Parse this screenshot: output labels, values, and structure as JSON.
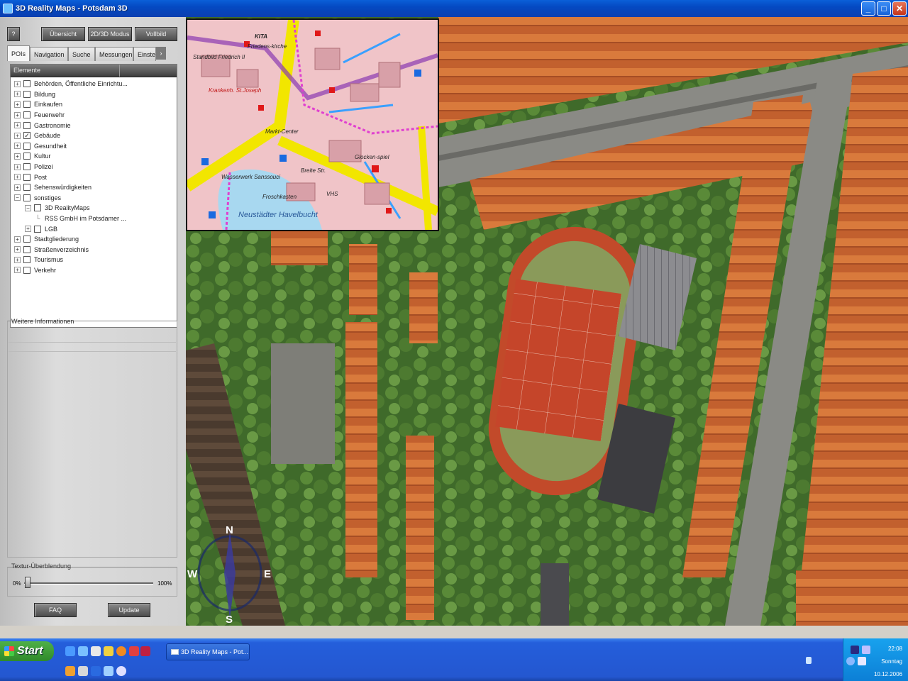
{
  "window": {
    "title": "3D Reality Maps - Potsdam 3D"
  },
  "window_controls": {
    "minimize": "_",
    "maximize": "□",
    "close": "✕"
  },
  "toolbar": {
    "help_label": "?",
    "overview_label": "Übersicht",
    "mode_label": "2D/3D Modus",
    "fullscreen_label": "Vollbild"
  },
  "tabs": [
    "POIs",
    "Navigation",
    "Suche",
    "Messungen",
    "Einstel"
  ],
  "tab_scroll": "›",
  "tree": {
    "column_header": "Elemente",
    "items": [
      {
        "label": "Behörden, Öffentliche Einrichtu...",
        "level": 0,
        "checked": false,
        "exp": "+"
      },
      {
        "label": "Bildung",
        "level": 0,
        "checked": false,
        "exp": "+"
      },
      {
        "label": "Einkaufen",
        "level": 0,
        "checked": false,
        "exp": "+"
      },
      {
        "label": "Feuerwehr",
        "level": 0,
        "checked": false,
        "exp": "+"
      },
      {
        "label": "Gastronomie",
        "level": 0,
        "checked": false,
        "exp": "+"
      },
      {
        "label": "Gebäude",
        "level": 0,
        "checked": true,
        "exp": "+"
      },
      {
        "label": "Gesundheit",
        "level": 0,
        "checked": false,
        "exp": "+"
      },
      {
        "label": "Kultur",
        "level": 0,
        "checked": false,
        "exp": "+"
      },
      {
        "label": "Polizei",
        "level": 0,
        "checked": false,
        "exp": "+"
      },
      {
        "label": "Post",
        "level": 0,
        "checked": false,
        "exp": "+"
      },
      {
        "label": "Sehenswürdigkeiten",
        "level": 0,
        "checked": false,
        "exp": "+"
      },
      {
        "label": "sonstiges",
        "level": 0,
        "checked": false,
        "exp": "−"
      },
      {
        "label": "3D RealityMaps",
        "level": 1,
        "checked": false,
        "exp": "−"
      },
      {
        "label": "RSS GmbH im Potsdamer ...",
        "level": 2,
        "checked": null,
        "exp": ""
      },
      {
        "label": "LGB",
        "level": 1,
        "checked": false,
        "exp": "+"
      },
      {
        "label": "Stadtgliederung",
        "level": 0,
        "checked": false,
        "exp": "+"
      },
      {
        "label": "Straßenverzeichnis",
        "level": 0,
        "checked": false,
        "exp": "+"
      },
      {
        "label": "Tourismus",
        "level": 0,
        "checked": false,
        "exp": "+"
      },
      {
        "label": "Verkehr",
        "level": 0,
        "checked": false,
        "exp": "+"
      }
    ]
  },
  "info": {
    "title": "Weitere Informationen"
  },
  "texture": {
    "title": "Textur-Überblendung",
    "min_label": "0%",
    "max_label": "100%",
    "value": 0
  },
  "buttons": {
    "faq_label": "FAQ",
    "update_label": "Update"
  },
  "map": {
    "overview_labels": [
      "Standbild Friedrich II",
      "KITA",
      "Friedens-kirche",
      "Krankenh. St.Joseph",
      "Markt-Center",
      "Glocken-spiel",
      "Wasserwerk Sanssouci",
      "Froschkasten",
      "Neustädter Havelbucht",
      "VHS",
      "Breite Str."
    ],
    "compass": {
      "n": "N",
      "s": "S",
      "e": "E",
      "w": "W"
    }
  },
  "taskbar": {
    "start_label": "Start",
    "task_label": "3D Reality Maps - Pot...",
    "clock_time": "22:08",
    "clock_day": "Sonntag",
    "clock_date": "10.12.2006"
  }
}
